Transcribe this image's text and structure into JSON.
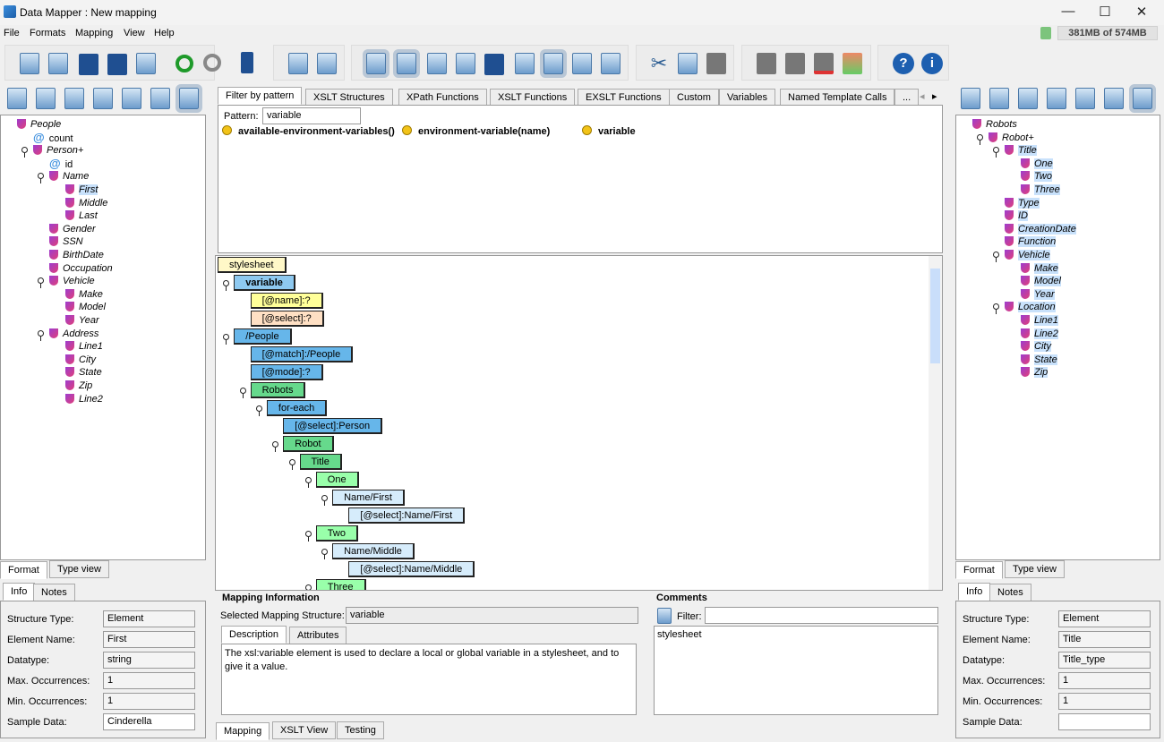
{
  "window": {
    "title": "Data Mapper : New mapping",
    "memory": "381MB of 574MB",
    "minimize": "—",
    "maximize": "☐",
    "close": "✕"
  },
  "menu": [
    "File",
    "Formats",
    "Mapping",
    "View",
    "Help"
  ],
  "left": {
    "tree": [
      {
        "label": "People",
        "depth": 0,
        "type": "el",
        "exp": false
      },
      {
        "label": "count",
        "depth": 1,
        "type": "attr"
      },
      {
        "label": "Person+",
        "depth": 1,
        "type": "el",
        "exp": true
      },
      {
        "label": "id",
        "depth": 2,
        "type": "attr"
      },
      {
        "label": "Name",
        "depth": 2,
        "type": "el",
        "exp": true
      },
      {
        "label": "First",
        "depth": 3,
        "type": "el",
        "selected": true
      },
      {
        "label": "Middle",
        "depth": 3,
        "type": "el"
      },
      {
        "label": "Last",
        "depth": 3,
        "type": "el"
      },
      {
        "label": "Gender",
        "depth": 2,
        "type": "el"
      },
      {
        "label": "SSN",
        "depth": 2,
        "type": "el"
      },
      {
        "label": "BirthDate",
        "depth": 2,
        "type": "el"
      },
      {
        "label": "Occupation",
        "depth": 2,
        "type": "el"
      },
      {
        "label": "Vehicle",
        "depth": 2,
        "type": "el",
        "exp": true
      },
      {
        "label": "Make",
        "depth": 3,
        "type": "el"
      },
      {
        "label": "Model",
        "depth": 3,
        "type": "el"
      },
      {
        "label": "Year",
        "depth": 3,
        "type": "el"
      },
      {
        "label": "Address",
        "depth": 2,
        "type": "el",
        "exp": true
      },
      {
        "label": "Line1",
        "depth": 3,
        "type": "el"
      },
      {
        "label": "City",
        "depth": 3,
        "type": "el"
      },
      {
        "label": "State",
        "depth": 3,
        "type": "el"
      },
      {
        "label": "Zip",
        "depth": 3,
        "type": "el"
      },
      {
        "label": "Line2",
        "depth": 3,
        "type": "el"
      }
    ],
    "view_tabs": [
      "Format",
      "Type view"
    ],
    "info_tabs": [
      "Info",
      "Notes"
    ],
    "info": {
      "structure_type_label": "Structure Type:",
      "structure_type": "Element",
      "element_name_label": "Element Name:",
      "element_name": "First",
      "datatype_label": "Datatype:",
      "datatype": "string",
      "max_label": "Max. Occurrences:",
      "max": "1",
      "min_label": "Min. Occurrences:",
      "min": "1",
      "sample_label": "Sample Data:",
      "sample": "Cinderella"
    }
  },
  "right": {
    "tree": [
      {
        "label": "Robots",
        "depth": 0,
        "type": "el"
      },
      {
        "label": "Robot+",
        "depth": 1,
        "type": "el",
        "exp": true
      },
      {
        "label": "Title",
        "depth": 2,
        "type": "el",
        "exp": true,
        "selected": true
      },
      {
        "label": "One",
        "depth": 3,
        "type": "el",
        "selected": true
      },
      {
        "label": "Two",
        "depth": 3,
        "type": "el",
        "selected": true
      },
      {
        "label": "Three",
        "depth": 3,
        "type": "el",
        "selected": true
      },
      {
        "label": "Type",
        "depth": 2,
        "type": "el",
        "selected": true
      },
      {
        "label": "ID",
        "depth": 2,
        "type": "el",
        "selected": true
      },
      {
        "label": "CreationDate",
        "depth": 2,
        "type": "el",
        "selected": true
      },
      {
        "label": "Function",
        "depth": 2,
        "type": "el",
        "selected": true
      },
      {
        "label": "Vehicle",
        "depth": 2,
        "type": "el",
        "exp": true,
        "selected": true
      },
      {
        "label": "Make",
        "depth": 3,
        "type": "el",
        "selected": true
      },
      {
        "label": "Model",
        "depth": 3,
        "type": "el",
        "selected": true
      },
      {
        "label": "Year",
        "depth": 3,
        "type": "el",
        "selected": true
      },
      {
        "label": "Location",
        "depth": 2,
        "type": "el",
        "exp": true,
        "selected": true
      },
      {
        "label": "Line1",
        "depth": 3,
        "type": "el",
        "selected": true
      },
      {
        "label": "Line2",
        "depth": 3,
        "type": "el",
        "selected": true
      },
      {
        "label": "City",
        "depth": 3,
        "type": "el",
        "selected": true
      },
      {
        "label": "State",
        "depth": 3,
        "type": "el",
        "selected": true
      },
      {
        "label": "Zip",
        "depth": 3,
        "type": "el",
        "selected": true
      }
    ],
    "view_tabs": [
      "Format",
      "Type view"
    ],
    "info_tabs": [
      "Info",
      "Notes"
    ],
    "info": {
      "structure_type_label": "Structure Type:",
      "structure_type": "Element",
      "element_name_label": "Element Name:",
      "element_name": "Title",
      "datatype_label": "Datatype:",
      "datatype": "Title_type",
      "max_label": "Max. Occurrences:",
      "max": "1",
      "min_label": "Min. Occurrences:",
      "min": "1",
      "sample_label": "Sample Data:",
      "sample": ""
    }
  },
  "center": {
    "function_tabs": [
      "Filter by pattern",
      "XSLT Structures",
      "XPath Functions",
      "XSLT Functions",
      "EXSLT Functions",
      "Custom",
      "Variables",
      "Named Template Calls",
      "..."
    ],
    "pattern_label": "Pattern:",
    "pattern": "variable",
    "functions": [
      "available-environment-variables()",
      "environment-variable(name)",
      "variable"
    ],
    "mapping_tree": [
      {
        "label": "stylesheet",
        "depth": 0,
        "color": "#fff8c8"
      },
      {
        "label": "variable",
        "depth": 1,
        "color": "#8ec9f0",
        "bold": true,
        "exp": true
      },
      {
        "label": "[@name]:?",
        "depth": 2,
        "color": "#ffff99"
      },
      {
        "label": "[@select]:?",
        "depth": 2,
        "color": "#ffe0c4"
      },
      {
        "label": "/People",
        "depth": 1,
        "color": "#66b6ea",
        "exp": true
      },
      {
        "label": "[@match]:/People",
        "depth": 2,
        "color": "#66b6ea"
      },
      {
        "label": "[@mode]:?",
        "depth": 2,
        "color": "#66b6ea"
      },
      {
        "label": "Robots",
        "depth": 2,
        "color": "#66d98c",
        "exp": true
      },
      {
        "label": "for-each",
        "depth": 3,
        "color": "#66b6ea",
        "exp": true
      },
      {
        "label": "[@select]:Person",
        "depth": 4,
        "color": "#66b6ea"
      },
      {
        "label": "Robot",
        "depth": 4,
        "color": "#66d98c",
        "exp": true
      },
      {
        "label": "Title",
        "depth": 5,
        "color": "#66d98c",
        "exp": true
      },
      {
        "label": "One",
        "depth": 6,
        "color": "#99ffaa",
        "exp": true
      },
      {
        "label": "Name/First",
        "depth": 7,
        "color": "#d6ecfb",
        "exp": true
      },
      {
        "label": "[@select]:Name/First",
        "depth": 8,
        "color": "#d6ecfb"
      },
      {
        "label": "Two",
        "depth": 6,
        "color": "#99ffaa",
        "exp": true
      },
      {
        "label": "Name/Middle",
        "depth": 7,
        "color": "#d6ecfb",
        "exp": true
      },
      {
        "label": "[@select]:Name/Middle",
        "depth": 8,
        "color": "#d6ecfb"
      },
      {
        "label": "Three",
        "depth": 6,
        "color": "#99ffaa",
        "exp": true
      }
    ],
    "mapping_info": {
      "title": "Mapping Information",
      "selected_label": "Selected Mapping Structure:",
      "selected": "variable",
      "tabs": [
        "Description",
        "Attributes"
      ],
      "description": "The xsl:variable element is used to declare a local or global variable in a stylesheet, and to give it a value."
    },
    "comments": {
      "title": "Comments",
      "filter_label": "Filter:",
      "filter": "",
      "text": "stylesheet"
    },
    "bottom_tabs": [
      "Mapping",
      "XSLT View",
      "Testing"
    ]
  }
}
